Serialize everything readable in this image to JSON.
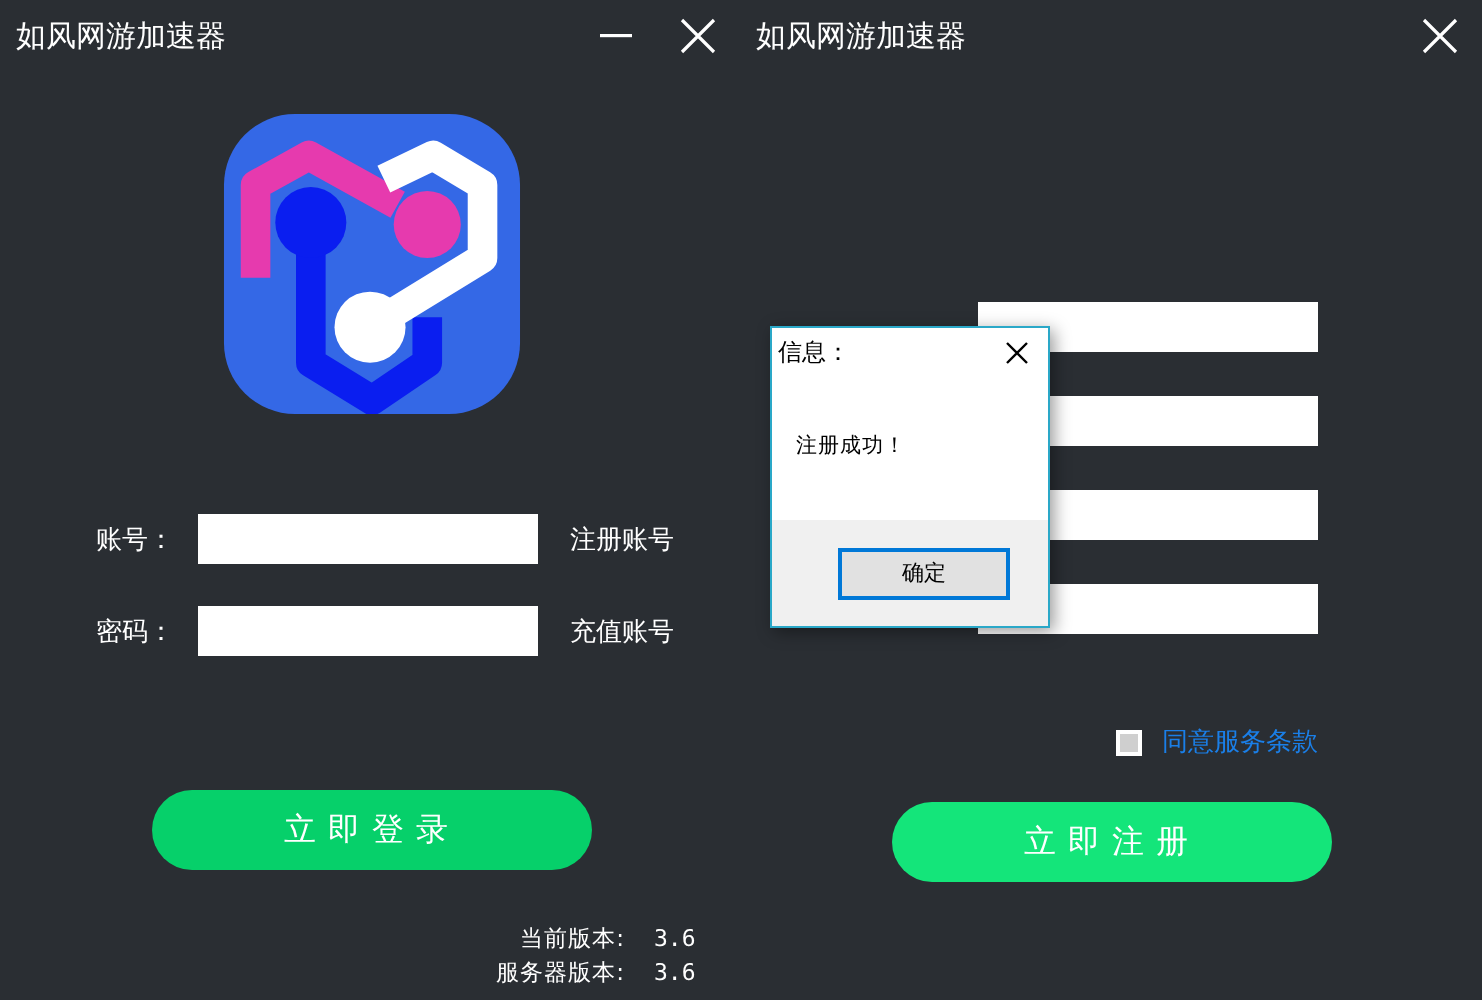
{
  "login_window": {
    "title": "如风网游加速器",
    "fields": [
      {
        "label": "账号：",
        "link": "注册账号"
      },
      {
        "label": "密码：",
        "link": "充值账号"
      }
    ],
    "login_button": "立即登录",
    "versions": [
      {
        "label": "当前版本:",
        "value": "3.6"
      },
      {
        "label": "服务器版本:",
        "value": "3.6"
      }
    ]
  },
  "register_window": {
    "title": "如风网游加速器",
    "fields": [
      {
        "kind": "text"
      },
      {
        "kind": "text"
      },
      {
        "kind": "text"
      },
      {
        "kind": "text"
      }
    ],
    "terms": {
      "label": "同意服务条款",
      "checked": false
    },
    "register_button": "立即注册"
  },
  "dialog": {
    "title": "信息：",
    "message": "注册成功！",
    "ok_button": "确定"
  }
}
